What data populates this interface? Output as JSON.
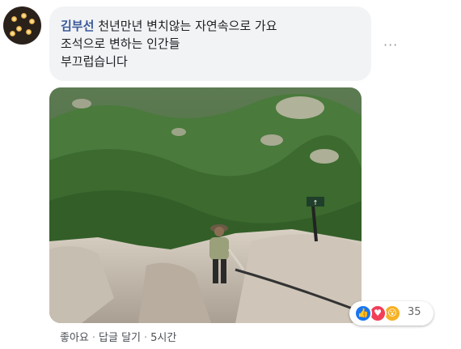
{
  "comment": {
    "author": "김부선",
    "text_line1": "천년만년 변치않는 자연속으로 가요",
    "text_line2": "조석으로 변하는 인간들",
    "text_line3": "부끄럽습니다"
  },
  "photo": {
    "sign_text": "↑"
  },
  "reactions": {
    "types": [
      "like-icon",
      "love-icon",
      "wow-icon"
    ],
    "like_glyph": "👍",
    "love_glyph": "♥",
    "wow_glyph": "😮",
    "count": "35"
  },
  "actions": {
    "like_label": "좋아요",
    "separator": "·",
    "reply_label": "답글 달기",
    "timestamp": "5시간"
  },
  "colors": {
    "author_link": "#385898",
    "bubble_bg": "#f2f3f5",
    "like_blue": "#1877f2",
    "love_red": "#f33e58",
    "wow_yellow": "#f7b125"
  }
}
